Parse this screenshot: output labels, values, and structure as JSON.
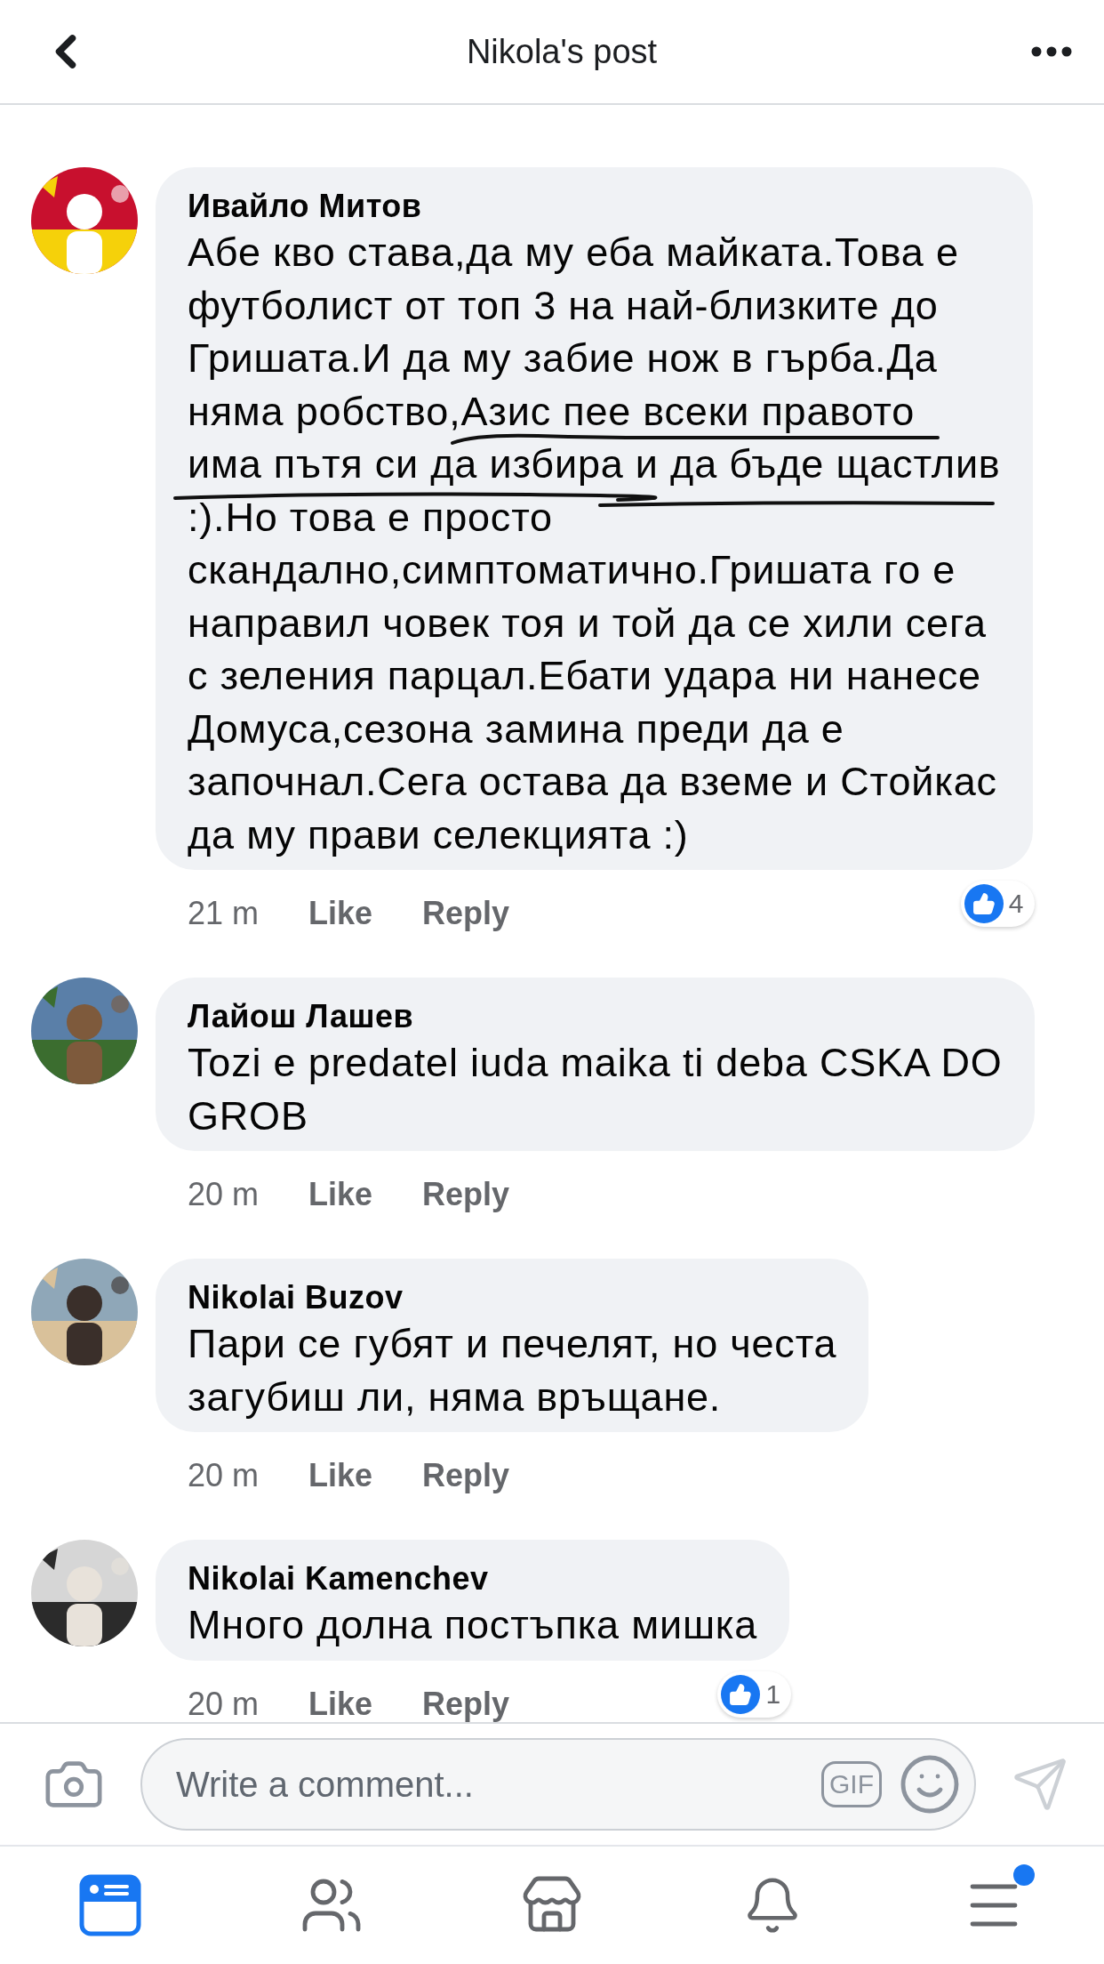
{
  "header": {
    "title": "Nikola's post"
  },
  "comments": [
    {
      "author": "Ивайло Митов",
      "text": "Абе кво става,да му еба майката.Това е\nфутболист от топ 3 на най-близките до\nГришата.И да му забие нож в гърба.Да\nняма робство,Азис пее всеки правото\nима пътя си да избира и да бъде щастлив\n:).Но това е просто\nскандално,симптоматично.Гришата го е\nнаправил човек тоя и той да се хили сега\nс зеления парцал.Ебати удара ни нанесе\nДомуса,сезона замина преди да е\nзапочнал.Сега остава да вземе и Стойкас\nда му прави селекцията :)",
      "annotated": true,
      "time": "21 m",
      "like": "Like",
      "reply": "Reply",
      "reactions": "4"
    },
    {
      "author": "Лайош Лашев",
      "text": "Tozi e predatel iuda maika ti deba CSKA DO\nGROB",
      "time": "20 m",
      "like": "Like",
      "reply": "Reply"
    },
    {
      "author": "Nikolai Buzov",
      "text": "Пари се губят и печелят, но честа\nзагубиш ли, няма връщане.",
      "time": "20 m",
      "like": "Like",
      "reply": "Reply"
    },
    {
      "author": "Nikolai Kamenchev",
      "text": "Много долна постъпка мишка",
      "time": "20 m",
      "like": "Like",
      "reply": "Reply",
      "reactions": "1"
    }
  ],
  "composer": {
    "placeholder": "Write a comment...",
    "gif_label": "GIF"
  },
  "tabs": [
    {
      "kind": "feed",
      "selected": true,
      "has_notification": false
    },
    {
      "kind": "friends",
      "selected": false,
      "has_notification": false
    },
    {
      "kind": "marketplace",
      "selected": false,
      "has_notification": false
    },
    {
      "kind": "notifications",
      "selected": false,
      "has_notification": false
    },
    {
      "kind": "menu",
      "selected": false,
      "has_notification": true
    }
  ]
}
